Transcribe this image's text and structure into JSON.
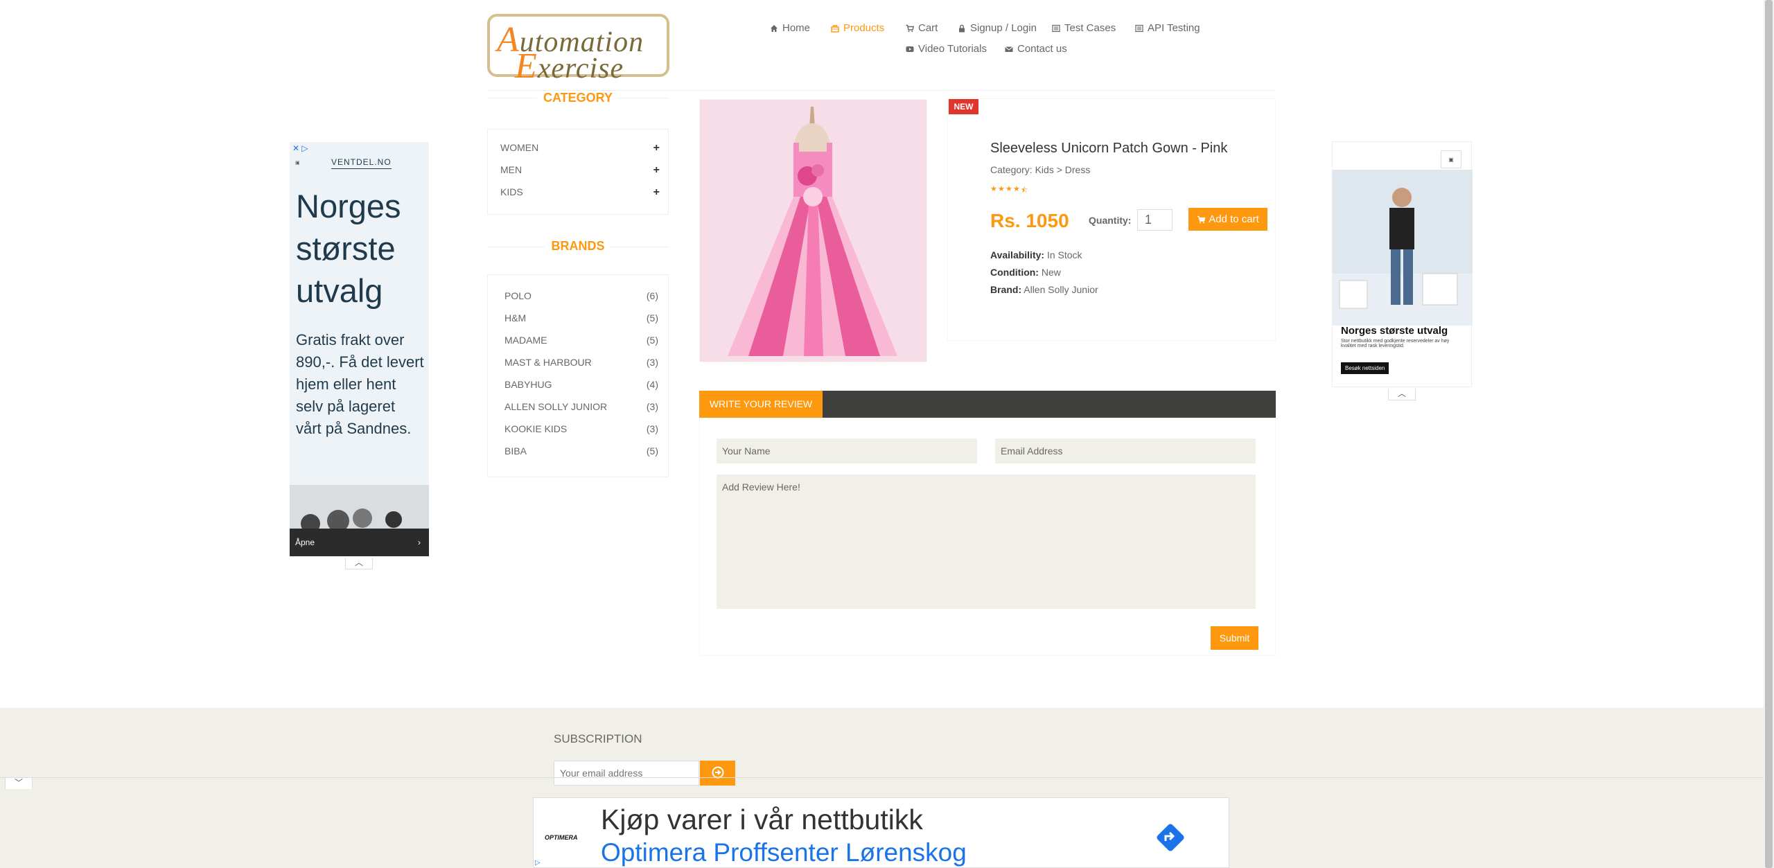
{
  "logo": {
    "line1": "Automation",
    "line2": "Exercise"
  },
  "nav": [
    {
      "label": "Home",
      "icon": "home-icon"
    },
    {
      "label": "Products",
      "icon": "products-icon",
      "active": true
    },
    {
      "label": "Cart",
      "icon": "cart-icon"
    },
    {
      "label": "Signup / Login",
      "icon": "lock-icon"
    },
    {
      "label": "Test Cases",
      "icon": "list-icon"
    },
    {
      "label": "API Testing",
      "icon": "list-icon"
    },
    {
      "label": "Video Tutorials",
      "icon": "youtube-icon"
    },
    {
      "label": "Contact us",
      "icon": "envelope-icon"
    }
  ],
  "sidebar": {
    "category_title": "CATEGORY",
    "categories": [
      "WOMEN",
      "MEN",
      "KIDS"
    ],
    "brands_title": "BRANDS",
    "brands": [
      {
        "name": "POLO",
        "count": "(6)"
      },
      {
        "name": "H&M",
        "count": "(5)"
      },
      {
        "name": "MADAME",
        "count": "(5)"
      },
      {
        "name": "MAST & HARBOUR",
        "count": "(3)"
      },
      {
        "name": "BABYHUG",
        "count": "(4)"
      },
      {
        "name": "ALLEN SOLLY JUNIOR",
        "count": "(3)"
      },
      {
        "name": "KOOKIE KIDS",
        "count": "(3)"
      },
      {
        "name": "BIBA",
        "count": "(5)"
      }
    ]
  },
  "product": {
    "badge": "NEW",
    "name": "Sleeveless Unicorn Patch Gown - Pink",
    "category": "Category: Kids > Dress",
    "rating": 4.5,
    "price": "Rs. 1050",
    "quantity_label": "Quantity:",
    "quantity": "1",
    "add_to_cart": "Add to cart",
    "availability_label": "Availability:",
    "availability": "In Stock",
    "condition_label": "Condition:",
    "condition": "New",
    "brand_label": "Brand:",
    "brand": "Allen Solly Junior"
  },
  "review": {
    "tab": "WRITE YOUR REVIEW",
    "name_placeholder": "Your Name",
    "email_placeholder": "Email Address",
    "review_placeholder": "Add Review Here!",
    "submit": "Submit"
  },
  "ads": {
    "left": {
      "brand": "VENTDEL.NO",
      "headline": "Norges største utvalg",
      "body": "Gratis frakt over 890,-. Få det levert hjem eller hent selv på lageret vårt på Sandnes.",
      "cta": "Åpne"
    },
    "right": {
      "headline": "Norges største utvalg",
      "body": "Stor nettbutikk med godkjente reservedeler av høy kvalitet med rask leveringstid.",
      "cta": "Besøk nettsiden"
    },
    "bottom": {
      "logo": "OPTIMERA",
      "line1": "Kjøp varer i vår nettbutikk",
      "line2": "Optimera Proffsenter Lørenskog"
    }
  },
  "footer": {
    "subscription_title": "SUBSCRIPTION",
    "email_placeholder": "Your email address"
  },
  "colors": {
    "accent": "#FE980F",
    "dark_bar": "#40403e",
    "input_bg": "#F0F0E9"
  }
}
